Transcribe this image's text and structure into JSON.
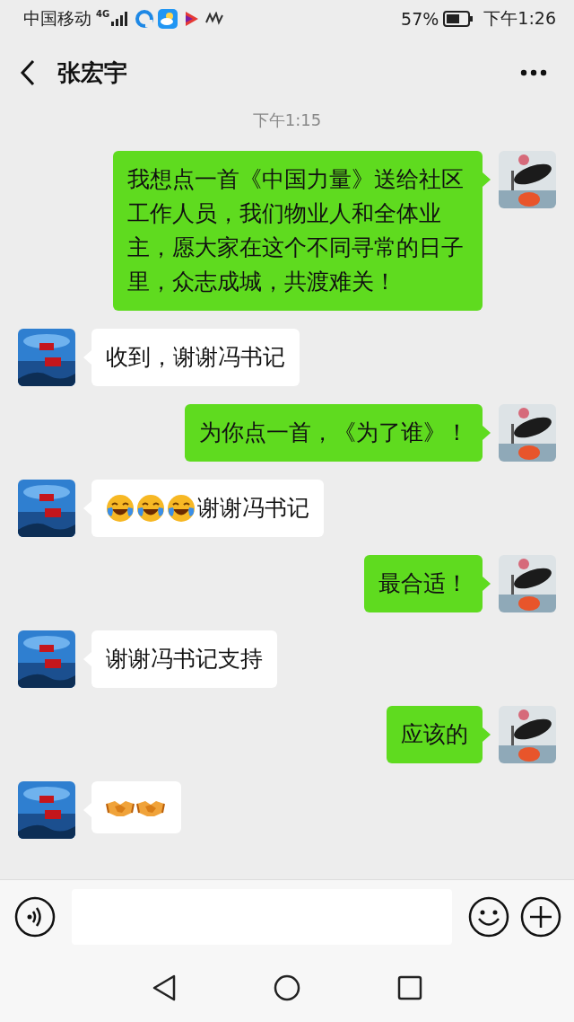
{
  "status_bar": {
    "carrier": "中国移动",
    "network": "4G",
    "battery": "57%",
    "time": "下午1:26"
  },
  "header": {
    "title": "张宏宇"
  },
  "timestamp": "下午1:15",
  "messages": [
    {
      "kind": "sent",
      "parts": [
        {
          "kind": "text",
          "text": "我想点一首《中国力量》送给社区工作人员，我们物业人和全体业主，愿大家在这个不同寻常的日子里，众志成城，共渡难关！"
        }
      ]
    },
    {
      "kind": "received",
      "parts": [
        {
          "kind": "text",
          "text": "收到，谢谢冯书记"
        }
      ]
    },
    {
      "kind": "sent",
      "parts": [
        {
          "kind": "text",
          "text": "为你点一首，《为了谁》！"
        }
      ]
    },
    {
      "kind": "received",
      "parts": [
        {
          "kind": "laughcry"
        },
        {
          "kind": "laughcry"
        },
        {
          "kind": "laughcry"
        },
        {
          "kind": "text",
          "text": "谢谢冯书记"
        }
      ]
    },
    {
      "kind": "sent",
      "parts": [
        {
          "kind": "text",
          "text": "最合适！"
        }
      ]
    },
    {
      "kind": "received",
      "parts": [
        {
          "kind": "text",
          "text": "谢谢冯书记支持"
        }
      ]
    },
    {
      "kind": "sent",
      "parts": [
        {
          "kind": "text",
          "text": "应该的"
        }
      ]
    },
    {
      "kind": "received",
      "parts": [
        {
          "kind": "handshake"
        },
        {
          "kind": "handshake"
        }
      ]
    }
  ]
}
